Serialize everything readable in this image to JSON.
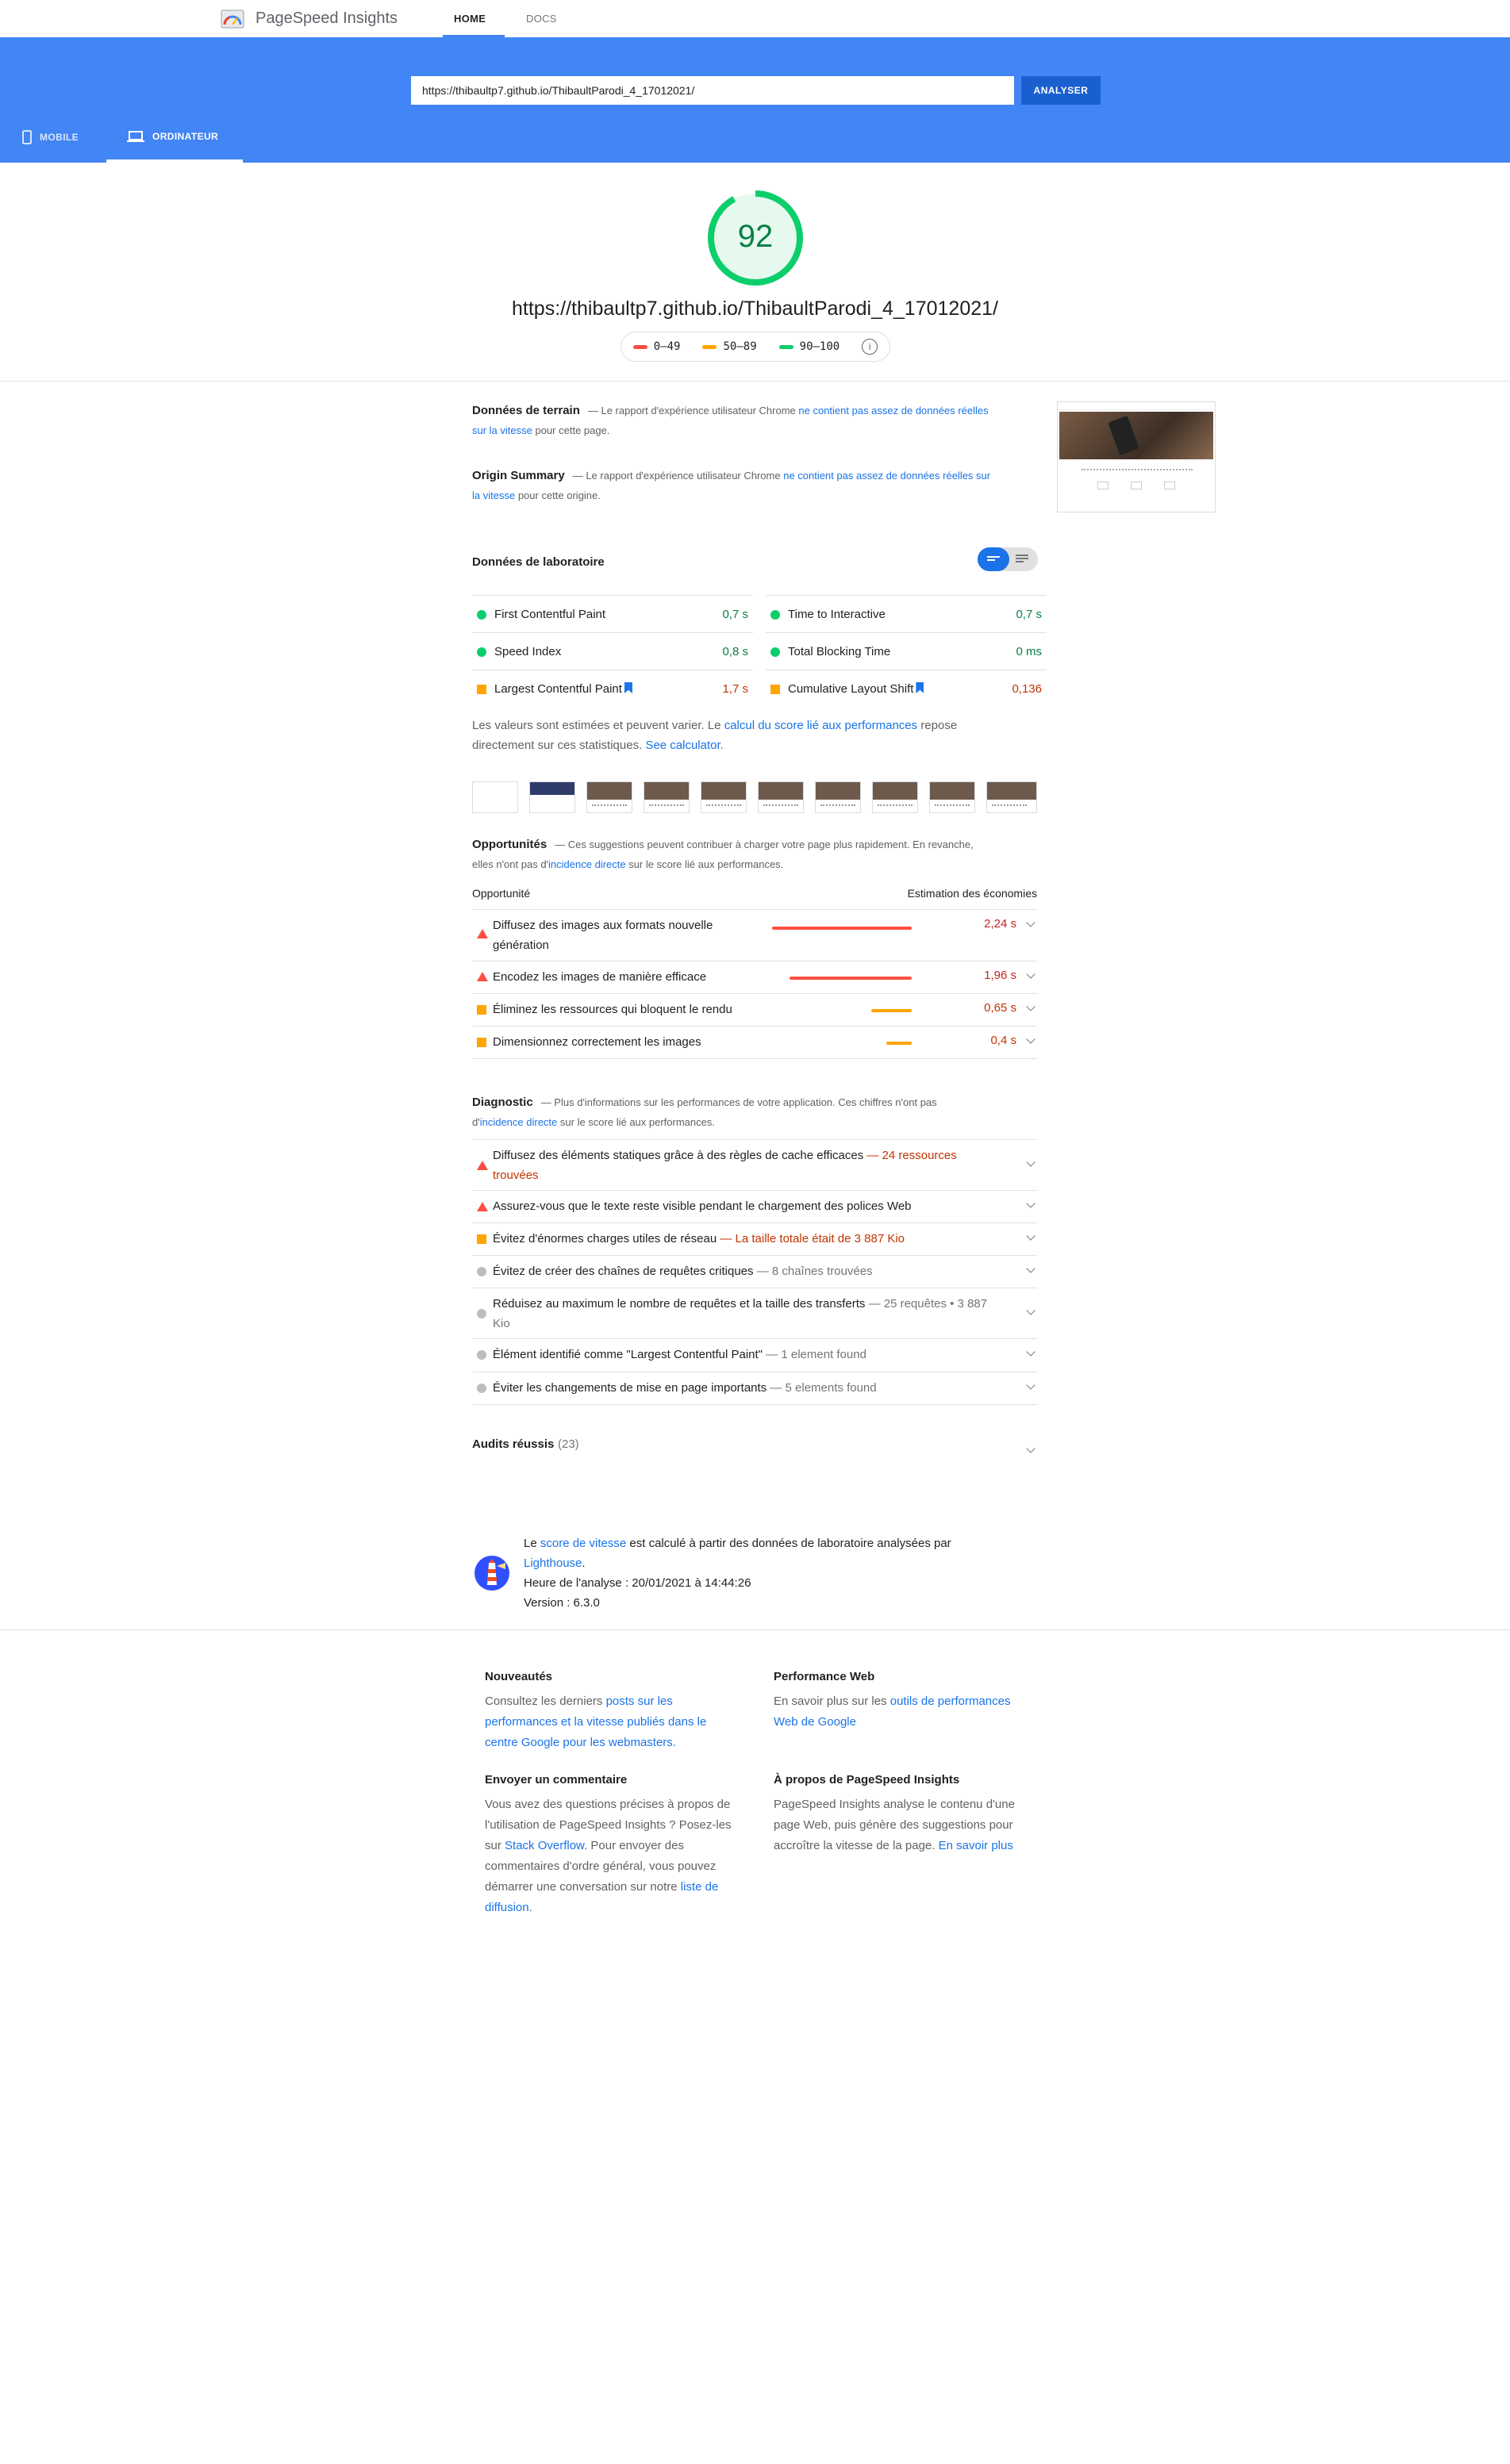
{
  "topnav": {
    "brand": "PageSpeed Insights",
    "tabs": [
      "HOME",
      "DOCS"
    ]
  },
  "search": {
    "url": "https://thibaultp7.github.io/ThibaultParodi_4_17012021/",
    "analyze_label": "ANALYSER"
  },
  "device_tabs": {
    "mobile": "MOBILE",
    "desktop": "ORDINATEUR"
  },
  "score": {
    "value": 92,
    "url": "https://thibaultp7.github.io/ThibaultParodi_4_17012021/",
    "legend": [
      "0–49",
      "50–89",
      "90–100"
    ],
    "colors": {
      "red": "#ff4e42",
      "orange": "#ffa400",
      "green": "#0cce6b"
    }
  },
  "field": {
    "title": "Données de terrain",
    "text_pre": "— Le rapport d'expérience utilisateur Chrome ",
    "link": "ne contient pas assez de données réelles sur la vitesse",
    "text_post": " pour cette page."
  },
  "origin": {
    "title": "Origin Summary",
    "text_pre": "— Le rapport d'expérience utilisateur Chrome ",
    "link": "ne contient pas assez de données réelles sur la vitesse",
    "text_post": " pour cette origine."
  },
  "lab": {
    "title": "Données de laboratoire",
    "metrics": [
      {
        "label": "First Contentful Paint",
        "value": "0,7 s",
        "status": "green"
      },
      {
        "label": "Time to Interactive",
        "value": "0,7 s",
        "status": "green"
      },
      {
        "label": "Speed Index",
        "value": "0,8 s",
        "status": "green"
      },
      {
        "label": "Total Blocking Time",
        "value": "0 ms",
        "status": "green"
      },
      {
        "label": "Largest Contentful Paint",
        "value": "1,7 s",
        "status": "orange"
      },
      {
        "label": "Cumulative Layout Shift",
        "value": "0,136",
        "status": "orange"
      }
    ],
    "note_pre": "Les valeurs sont estimées et peuvent varier. Le ",
    "note_link": "calcul du score lié aux performances",
    "note_mid": " repose directement sur ces statistiques. ",
    "note_link2": "See calculator."
  },
  "opportunities": {
    "title": "Opportunités",
    "desc_pre": "— Ces suggestions peuvent contribuer à charger votre page plus rapidement. En revanche, elles n'ont pas d'",
    "desc_link": "incidence directe",
    "desc_post": " sur le score lié aux performances.",
    "col_left": "Opportunité",
    "col_right": "Estimation des économies",
    "items": [
      {
        "label": "Diffusez des images aux formats nouvelle génération",
        "value": "2,24 s",
        "status": "red",
        "savings_fraction": 1.0
      },
      {
        "label": "Encodez les images de manière efficace",
        "value": "1,96 s",
        "status": "red",
        "savings_fraction": 0.875
      },
      {
        "label": "Éliminez les ressources qui bloquent le rendu",
        "value": "0,65 s",
        "status": "orange",
        "savings_fraction": 0.29
      },
      {
        "label": "Dimensionnez correctement les images",
        "value": "0,4 s",
        "status": "orange",
        "savings_fraction": 0.18
      }
    ]
  },
  "diagnostics": {
    "title": "Diagnostic",
    "desc_pre": "— Plus d'informations sur les performances de votre application. Ces chiffres n'ont pas d'",
    "desc_link": "incidence directe",
    "desc_post": " sur le score lié aux performances.",
    "items": [
      {
        "label": "Diffusez des éléments statiques grâce à des règles de cache efficaces",
        "sub": "— 24 ressources trouvées",
        "status": "red"
      },
      {
        "label": "Assurez-vous que le texte reste visible pendant le chargement des polices Web",
        "sub": "",
        "status": "red"
      },
      {
        "label": "Évitez d'énormes charges utiles de réseau",
        "sub": "— La taille totale était de 3 887 Kio",
        "status": "orange"
      },
      {
        "label": "Évitez de créer des chaînes de requêtes critiques",
        "sub": "— 8 chaînes trouvées",
        "status": "grey"
      },
      {
        "label": "Réduisez au maximum le nombre de requêtes et la taille des transferts",
        "sub": "— 25 requêtes • 3 887 Kio",
        "status": "grey"
      },
      {
        "label": "Élément identifié comme \"Largest Contentful Paint\"",
        "sub": "— 1 element found",
        "status": "grey"
      },
      {
        "label": "Éviter les changements de mise en page importants",
        "sub": "— 5 elements found",
        "status": "grey"
      }
    ]
  },
  "passed": {
    "title": "Audits réussis",
    "count": "(23)"
  },
  "lighthouse": {
    "pre": "Le ",
    "link1": "score de vitesse",
    "mid": " est calculé à partir des données de laboratoire analysées par ",
    "link2": "Lighthouse",
    "post": ".",
    "time": "Heure de l'analyse : 20/01/2021 à 14:44:26",
    "version": "Version : 6.3.0"
  },
  "footer": {
    "news": {
      "title": "Nouveautés",
      "pre": "Consultez les derniers ",
      "link": "posts sur les performances et la vitesse publiés dans le centre Google pour les webmasters."
    },
    "perf": {
      "title": "Performance Web",
      "pre": "En savoir plus sur les ",
      "link": "outils de performances Web de Google"
    },
    "feedback": {
      "title": "Envoyer un commentaire",
      "pre": "Vous avez des questions précises à propos de l'utilisation de PageSpeed Insights ? Posez-les sur ",
      "link": "Stack Overflow",
      "mid": ". Pour envoyer des commentaires d'ordre général, vous pouvez démarrer une conversation sur notre ",
      "link2": "liste de diffusion",
      "post": "."
    },
    "about": {
      "title": "À propos de PageSpeed Insights",
      "pre": "PageSpeed Insights analyse le contenu d'une page Web, puis génère des suggestions pour accroître la vitesse de la page. ",
      "link": "En savoir plus"
    }
  }
}
